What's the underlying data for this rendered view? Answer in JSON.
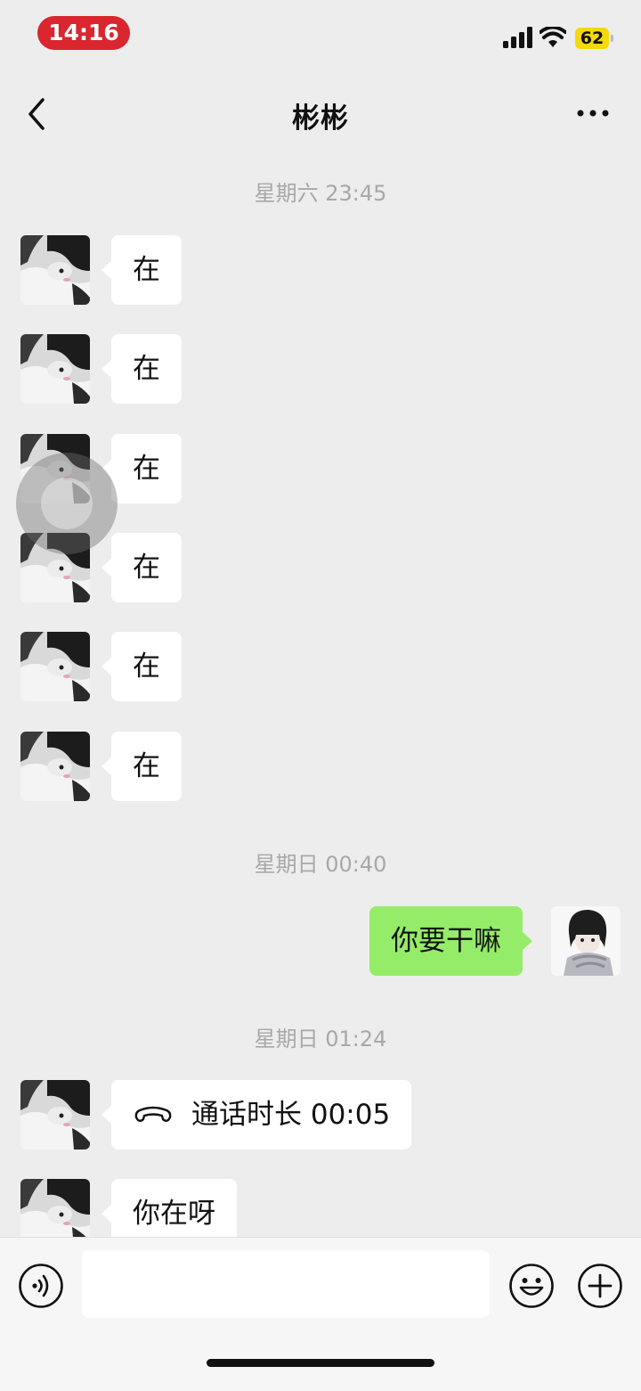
{
  "status_bar": {
    "time": "14:16",
    "battery": "62"
  },
  "header": {
    "title": "彬彬"
  },
  "messages": {
    "divider_1": "星期六 23:45",
    "msg_1": "在",
    "msg_2": "在",
    "msg_3": "在",
    "msg_4": "在",
    "msg_5": "在",
    "msg_6": "在",
    "divider_2": "星期日 00:40",
    "msg_7": "你要干嘛",
    "divider_3": "星期日 01:24",
    "msg_8": "通话时长 00:05",
    "msg_9": "你在呀"
  },
  "input_bar": {
    "value": "",
    "placeholder": ""
  },
  "icons": {
    "back": "back-arrow-icon",
    "more": "more-dots-icon",
    "call": "phone-hangup-icon",
    "voice": "voice-icon",
    "emoji": "emoji-icon",
    "plus": "plus-icon"
  },
  "colors": {
    "background": "#ededed",
    "incoming_bubble": "#ffffff",
    "outgoing_bubble": "#95ec69",
    "time_pill": "#d9262f",
    "battery": "#f5d90a"
  }
}
